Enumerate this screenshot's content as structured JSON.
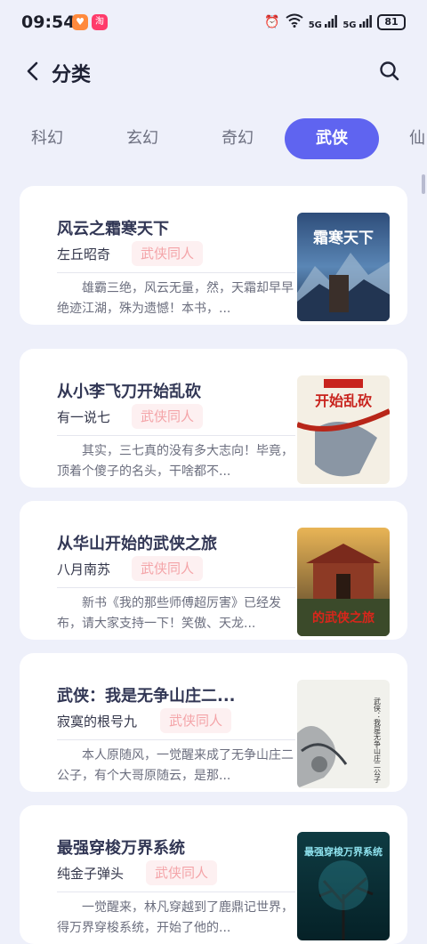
{
  "status_bar": {
    "time": "09:54",
    "battery": "81",
    "net1": "5G",
    "net2": "5G"
  },
  "header": {
    "title": "分类"
  },
  "tabs": [
    {
      "label": "科幻",
      "active": false
    },
    {
      "label": "玄幻",
      "active": false
    },
    {
      "label": "奇幻",
      "active": false
    },
    {
      "label": "武侠",
      "active": true
    },
    {
      "label": "仙",
      "active": false
    }
  ],
  "books": [
    {
      "title": "风云之霜寒天下",
      "author": "左丘昭奇",
      "tag": "武侠同人",
      "summary": "雄霸三绝，风云无量，然，天霜却早早绝迹江湖，殊为遗憾！本书，...",
      "cover_text": "霜寒天下"
    },
    {
      "title": "从小李飞刀开始乱砍",
      "author": "有一说七",
      "tag": "武侠同人",
      "summary": "其实，三七真的没有多大志向！毕竟，顶着个傻子的名头，干啥都不...",
      "cover_text": "开始乱砍"
    },
    {
      "title": "从华山开始的武侠之旅",
      "author": "八月南苏",
      "tag": "武侠同人",
      "summary": "新书《我的那些师傅超厉害》已经发布，请大家支持一下！笑傲、天龙...",
      "cover_text": "的武侠之旅"
    },
    {
      "title": "武侠：我是无争山庄二...",
      "author": "寂寞的根号九",
      "tag": "武侠同人",
      "summary": "本人原随风，一觉醒来成了无争山庄二公子，有个大哥原随云，是那...",
      "cover_text": "武侠：我是无争山庄二公子"
    },
    {
      "title": "最强穿梭万界系统",
      "author": "纯金子弹头",
      "tag": "武侠同人",
      "summary": "一觉醒来，林凡穿越到了鹿鼎记世界，得万界穿梭系统，开始了他的...",
      "cover_text": "最强穿梭万界系统"
    }
  ]
}
